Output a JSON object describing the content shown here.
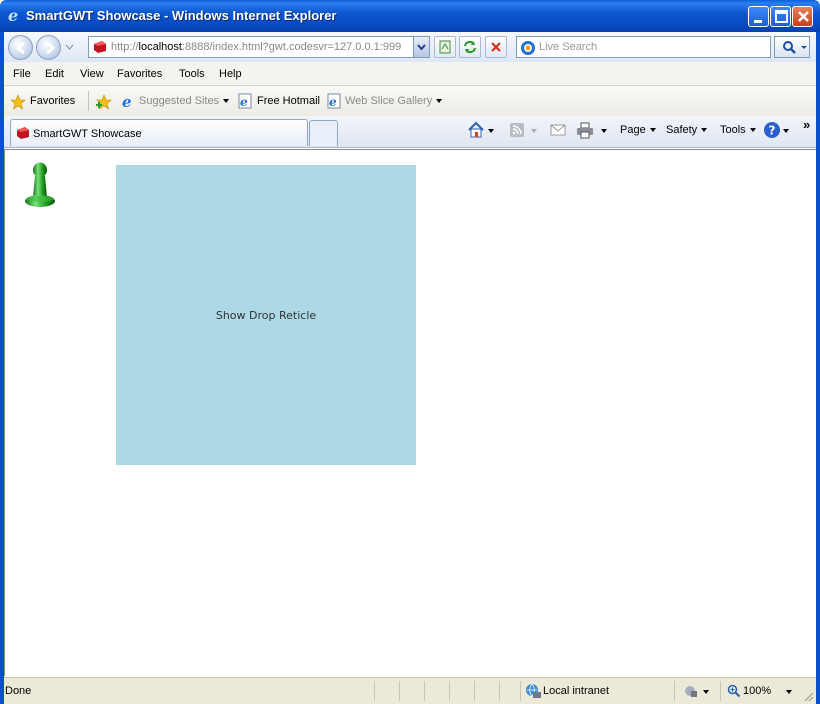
{
  "window": {
    "title": "SmartGWT Showcase - Windows Internet Explorer"
  },
  "address_bar": {
    "url_prefix": "http://",
    "url_host": "localhost",
    "url_rest": ":8888/index.html?gwt.codesvr=127.0.0.1:999",
    "search_placeholder": "Live Search"
  },
  "menu": {
    "items": [
      "File",
      "Edit",
      "View",
      "Favorites",
      "Tools",
      "Help"
    ]
  },
  "favorites_bar": {
    "favorites_label": "Favorites",
    "links": [
      {
        "label": "Suggested Sites",
        "disabled": true
      },
      {
        "label": "Free Hotmail",
        "disabled": false
      },
      {
        "label": "Web Slice Gallery",
        "disabled": true
      }
    ]
  },
  "tabs": {
    "active_tab": "SmartGWT Showcase"
  },
  "command_bar": {
    "page": "Page",
    "safety": "Safety",
    "tools": "Tools",
    "chevron": "»"
  },
  "content": {
    "drop_target_label": "Show Drop Reticle",
    "drop_target_color": "#add8e6"
  },
  "status_bar": {
    "status": "Done",
    "zone": "Local intranet",
    "zoom": "100%"
  }
}
